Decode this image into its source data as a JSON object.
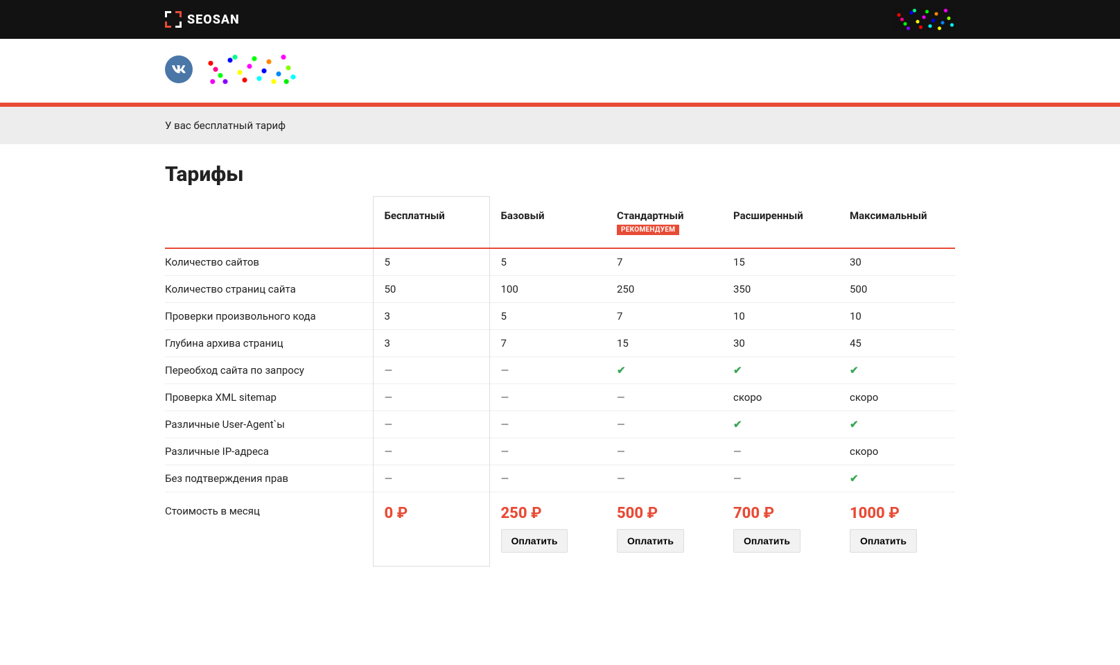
{
  "brand": "SEOSAN",
  "vk_label": "VK",
  "notice": "У вас бесплатный тариф",
  "heading": "Тарифы",
  "recommend_badge": "РЕКОМЕНДУЕМ",
  "currency": "₽",
  "price_label": "Стоимость в месяц",
  "pay_label": "Оплатить",
  "plans": [
    {
      "name": "Бесплатный",
      "price": "0"
    },
    {
      "name": "Базовый",
      "price": "250"
    },
    {
      "name": "Стандартный",
      "price": "500",
      "recommended": true
    },
    {
      "name": "Расширенный",
      "price": "700"
    },
    {
      "name": "Максимальный",
      "price": "1000"
    }
  ],
  "features": [
    {
      "label": "Количество сайтов",
      "values": [
        "5",
        "5",
        "7",
        "15",
        "30"
      ]
    },
    {
      "label": "Количество страниц сайта",
      "values": [
        "50",
        "100",
        "250",
        "350",
        "500"
      ]
    },
    {
      "label": "Проверки произвольного кода",
      "values": [
        "3",
        "5",
        "7",
        "10",
        "10"
      ]
    },
    {
      "label": "Глубина архива страниц",
      "values": [
        "3",
        "7",
        "15",
        "30",
        "45"
      ]
    },
    {
      "label": "Переобход сайта по запросу",
      "values": [
        "—",
        "—",
        "✔",
        "✔",
        "✔"
      ]
    },
    {
      "label": "Проверка XML sitemap",
      "values": [
        "—",
        "—",
        "—",
        "скоро",
        "скоро"
      ]
    },
    {
      "label": "Различные User-Agent`ы",
      "values": [
        "—",
        "—",
        "—",
        "✔",
        "✔"
      ]
    },
    {
      "label": "Различные IP-адреса",
      "values": [
        "—",
        "—",
        "—",
        "—",
        "скоро"
      ]
    },
    {
      "label": "Без подтверждения прав",
      "values": [
        "—",
        "—",
        "—",
        "—",
        "✔"
      ]
    }
  ]
}
